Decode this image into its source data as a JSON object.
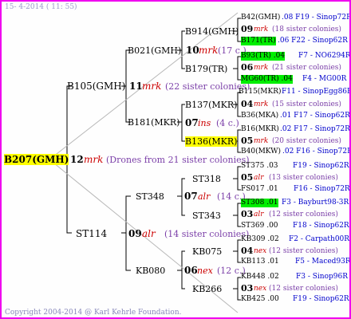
{
  "header": "15-  4-2014 ( 11: 55)",
  "footer": "Copyright 2004-2014 @ Karl Kehrle Foundation.",
  "root": {
    "id": "B207(GMH)",
    "gen": "12",
    "mark": "mrk",
    "desc": "(Drones from 21 sister colonies)"
  },
  "upper": {
    "id": "B105(GMH)",
    "gen": "11",
    "mark": "mrk",
    "desc": "(22 sister colonies)",
    "a": {
      "id": "B021(GMH)",
      "gen": "10",
      "mark": "mrk",
      "desc": "(17 c.)",
      "a": {
        "id": "B914(GMH)",
        "gen": "09",
        "mark": "mrk",
        "desc": "(18 sister colonies)",
        "a": {
          "id": "B42(GMH)",
          "info": ".08 F19 - Sinop72R"
        },
        "b": {
          "id": "B171(TR)",
          "info": ".06   F22 - Sinop62R"
        }
      },
      "b": {
        "id": "B179(TR)",
        "gen": "06",
        "mark": "mrk",
        "desc": "(21 sister colonies)",
        "a": {
          "id": "B93(TR) .04",
          "info": "F7 - NO6294R"
        },
        "b": {
          "id": "MG60(TR) .04",
          "info": "F4 - MG00R"
        }
      }
    },
    "b": {
      "id": "B181(MKR)",
      "gen": "07",
      "mark": "ins",
      "desc": "(4 c.)",
      "a": {
        "id": "B137(MKR)",
        "gen": "04",
        "mark": "mrk",
        "desc": "(15 sister colonies)",
        "a": {
          "id": "B115(MKR)",
          "info": "F11 - SinopEgg86R"
        },
        "b": {
          "id": "B36(MKA)",
          "info": ".01 F17 - Sinop62R"
        }
      },
      "b": {
        "id": "B136(MKR)",
        "gen": "05",
        "mark": "mrk",
        "desc": "(20 sister colonies)",
        "a": {
          "id": "B16(MKR)",
          "info": ".02 F17 - Sinop72R"
        },
        "b": {
          "id": "B40(MKW)",
          "info": ".02 F16 - Sinop72R"
        }
      }
    }
  },
  "lower": {
    "id": "ST114",
    "gen": "09",
    "mark": "alr",
    "desc": "(14 sister colonies)",
    "a": {
      "id": "ST348",
      "gen": "07",
      "mark": "alr",
      "desc": "(14 c.)",
      "a": {
        "id": "ST318",
        "gen": "05",
        "mark": "alr",
        "desc": "(13 sister colonies)",
        "a": {
          "id": "ST375 .03",
          "info": "F19 - Sinop62R"
        },
        "b": {
          "id": "FS017 .01",
          "info": "F16 - Sinop72R"
        }
      },
      "b": {
        "id": "ST343",
        "gen": "03",
        "mark": "alr",
        "desc": "(12 sister colonies)",
        "a": {
          "id": "ST308 .01",
          "info": "F3 - Bayburt98-3R"
        },
        "b": {
          "id": "ST369 .00",
          "info": "F18 - Sinop62R"
        }
      }
    },
    "b": {
      "id": "KB080",
      "gen": "06",
      "mark": "nex",
      "desc": "(12 c.)",
      "a": {
        "id": "KB075",
        "gen": "04",
        "mark": "nex",
        "desc": "(12 sister colonies)",
        "a": {
          "id": "KB309 .02",
          "info": "F2 - Carpath00R"
        },
        "b": {
          "id": "KB113 .01",
          "info": "F5 - Maced93R"
        }
      },
      "b": {
        "id": "KB266",
        "gen": "03",
        "mark": "nex",
        "desc": "(12 sister colonies)",
        "a": {
          "id": "KB448 .02",
          "info": "F3 - Sinop96R"
        },
        "b": {
          "id": "KB425 .00",
          "info": "F19 - Sinop62R"
        }
      }
    }
  },
  "colors": {
    "frame": "#f000f0",
    "highlight_yellow": "#ffff00",
    "highlight_green": "#00ee00",
    "mark_red": "#cc0000",
    "desc_purple": "#7b3fa8",
    "info_blue": "#0000cc"
  }
}
